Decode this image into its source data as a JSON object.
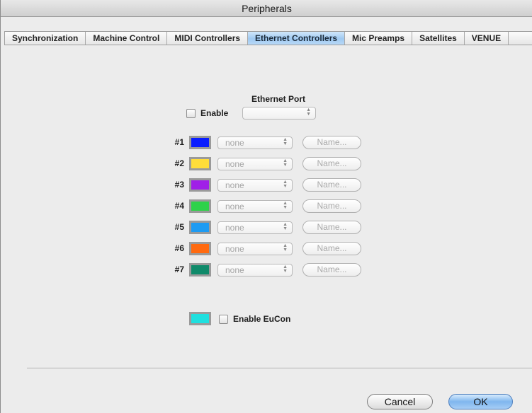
{
  "window": {
    "title": "Peripherals"
  },
  "tabs": [
    {
      "label": "Synchronization",
      "active": false
    },
    {
      "label": "Machine Control",
      "active": false
    },
    {
      "label": "MIDI Controllers",
      "active": false
    },
    {
      "label": "Ethernet Controllers",
      "active": true
    },
    {
      "label": "Mic Preamps",
      "active": false
    },
    {
      "label": "Satellites",
      "active": false
    },
    {
      "label": "VENUE",
      "active": false
    }
  ],
  "ethernet": {
    "port_label": "Ethernet Port",
    "enable_label": "Enable",
    "enable_checked": false,
    "port_value": ""
  },
  "controllers": [
    {
      "number": "#1",
      "color": "#0a1dff",
      "value": "none",
      "name_button": "Name..."
    },
    {
      "number": "#2",
      "color": "#ffdd3a",
      "value": "none",
      "name_button": "Name..."
    },
    {
      "number": "#3",
      "color": "#a01fe8",
      "value": "none",
      "name_button": "Name..."
    },
    {
      "number": "#4",
      "color": "#2ed24a",
      "value": "none",
      "name_button": "Name..."
    },
    {
      "number": "#5",
      "color": "#1e9bf2",
      "value": "none",
      "name_button": "Name..."
    },
    {
      "number": "#6",
      "color": "#ff6a10",
      "value": "none",
      "name_button": "Name..."
    },
    {
      "number": "#7",
      "color": "#0f8a6a",
      "value": "none",
      "name_button": "Name..."
    }
  ],
  "eucon": {
    "color": "#1fe0df",
    "label": "Enable EuCon",
    "checked": false
  },
  "buttons": {
    "cancel": "Cancel",
    "ok": "OK"
  },
  "icons": {
    "popup_arrows": "up-down-arrows-icon"
  }
}
